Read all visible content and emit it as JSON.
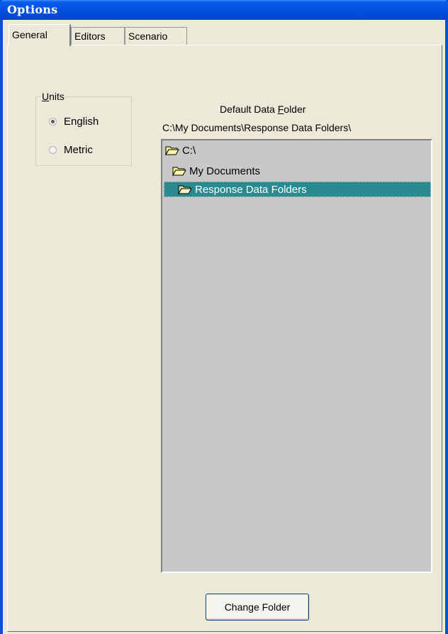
{
  "window": {
    "title": "Options"
  },
  "tabs": [
    {
      "label": "General",
      "active": true
    },
    {
      "label": "Editors",
      "active": false
    },
    {
      "label": "Scenario",
      "active": false
    }
  ],
  "units": {
    "legend_prefix": "U",
    "legend_rest": "nits",
    "options": [
      {
        "label": "English",
        "checked": true
      },
      {
        "label": "Metric",
        "checked": false
      }
    ]
  },
  "default_folder": {
    "heading_before": "Default Data ",
    "heading_accel": "F",
    "heading_after": "older",
    "path": "C:\\My Documents\\Response Data Folders\\"
  },
  "tree": {
    "items": [
      {
        "label": "C:\\",
        "icon": "folder-open-icon",
        "selected": false
      },
      {
        "label": "My Documents",
        "icon": "folder-open-icon",
        "selected": false
      },
      {
        "label": "Response Data Folders",
        "icon": "folder-open-icon",
        "selected": true
      }
    ]
  },
  "change_folder_label": "Change Folder",
  "colors": {
    "title_bar": "#0351e0",
    "selection": "#2b8a8f",
    "tree_background": "#c8c8c8"
  }
}
